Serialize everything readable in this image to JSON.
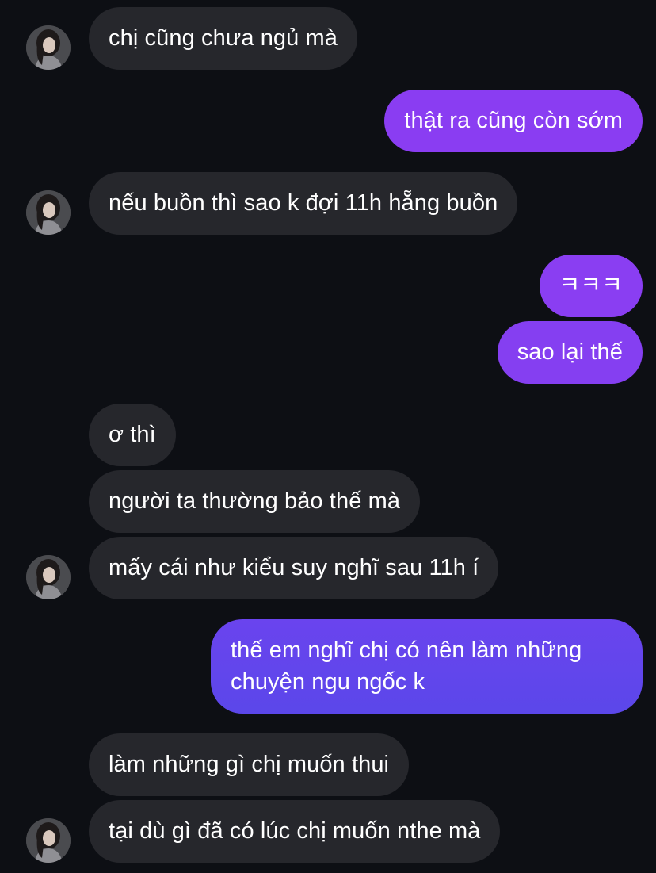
{
  "conversation": {
    "messages": [
      {
        "from": "contact",
        "text": "chị cũng chưa ngủ mà"
      },
      {
        "from": "me",
        "text": "thật ra cũng còn sớm"
      },
      {
        "from": "contact",
        "text": "nếu buồn thì sao k đợi 11h hẵng buồn"
      },
      {
        "from": "me",
        "text": "ㅋㅋㅋ"
      },
      {
        "from": "me",
        "text": "sao lại thế"
      },
      {
        "from": "contact",
        "text": "ơ thì"
      },
      {
        "from": "contact",
        "text": "người ta thường bảo thế mà"
      },
      {
        "from": "contact",
        "text": "mấy cái như kiểu suy nghĩ sau 11h í"
      },
      {
        "from": "me",
        "text": "thế em nghĩ chị có nên làm những chuyện ngu ngốc k"
      },
      {
        "from": "contact",
        "text": "làm những gì chị muốn thui"
      },
      {
        "from": "contact",
        "text": "tại dù gì đã có lúc chị muốn nthe mà"
      }
    ]
  },
  "colors": {
    "background": "#0d0f14",
    "incoming_bubble": "#26272c",
    "outgoing_bubble_top": "#8b3cf2",
    "outgoing_bubble_bottom": "#5b47ea"
  },
  "icons": {
    "contact_avatar": "profile-photo"
  }
}
